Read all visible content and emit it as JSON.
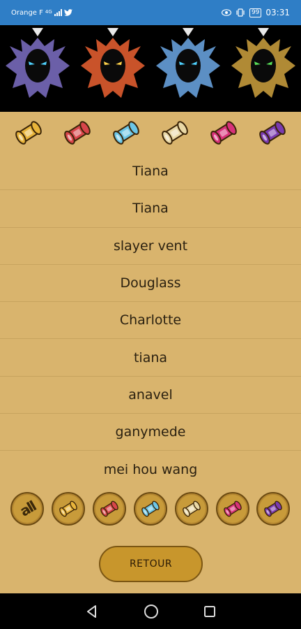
{
  "status_bar": {
    "carrier": "Orange F",
    "network": "4G",
    "battery": "99",
    "time": "03:31"
  },
  "banner": {
    "figures": [
      {
        "name": "purple-dragon-icon",
        "color": "#6b5fa8",
        "eye": "#4fd2ff"
      },
      {
        "name": "red-dragon-icon",
        "color": "#c9532a",
        "eye": "#ffd24a"
      },
      {
        "name": "blue-dragon-icon",
        "color": "#5c8fc4",
        "eye": "#4fd2ff"
      },
      {
        "name": "green-dragon-icon",
        "color": "#b08a35",
        "eye": "#59e05a"
      }
    ]
  },
  "filters": [
    {
      "name": "gold-scroll-icon",
      "color": "#e8b43a"
    },
    {
      "name": "red-scroll-icon",
      "color": "#d8454a"
    },
    {
      "name": "blue-scroll-icon",
      "color": "#6cc6e6"
    },
    {
      "name": "cream-scroll-icon",
      "color": "#e9d8a6"
    },
    {
      "name": "pink-scroll-icon",
      "color": "#d8327a"
    },
    {
      "name": "purple-scroll-icon",
      "color": "#7a3bb0"
    }
  ],
  "list": [
    "Tiana",
    "Tiana",
    "slayer vent",
    "Douglass",
    "Charlotte",
    "tiana",
    "anavel",
    "ganymede",
    "mei hou wang"
  ],
  "categories": {
    "all_label": "all",
    "items": [
      {
        "name": "gold-scroll-icon",
        "color": "#e8b43a"
      },
      {
        "name": "red-scroll-icon",
        "color": "#d8454a"
      },
      {
        "name": "blue-scroll-icon",
        "color": "#6cc6e6"
      },
      {
        "name": "cream-scroll-icon",
        "color": "#e9d8a6"
      },
      {
        "name": "pink-scroll-icon",
        "color": "#d8327a"
      },
      {
        "name": "purple-scroll-icon",
        "color": "#7a3bb0"
      }
    ]
  },
  "back_button": {
    "label": "RETOUR"
  },
  "colors": {
    "background": "#d9b46d",
    "status_bar": "#2f7ec6",
    "button": "#c8962c"
  }
}
